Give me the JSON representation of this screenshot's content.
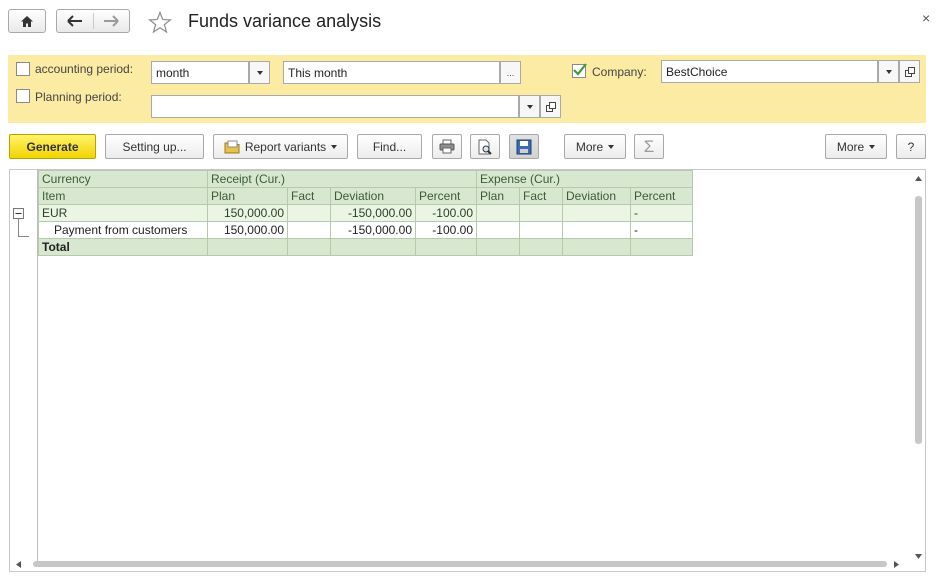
{
  "window": {
    "title": "Funds variance analysis",
    "close_glyph": "×",
    "nav_icons": [
      "home-icon",
      "back-arrow-icon",
      "forward-arrow-icon",
      "favorite-star-icon"
    ]
  },
  "filters": {
    "accounting_period": {
      "checked": false,
      "label": "accounting period:",
      "period_type": "month",
      "period_value": "This month",
      "select_button": "..."
    },
    "planning_period": {
      "checked": false,
      "label": "Planning period:",
      "value": ""
    },
    "company": {
      "checked": true,
      "label": "Company:",
      "value": "BestChoice"
    }
  },
  "toolbar": {
    "generate": "Generate",
    "setting_up": "Setting up...",
    "report_variants": "Report variants",
    "find": "Find...",
    "more_left": "More",
    "sum_symbol": "Σ",
    "more_right": "More",
    "help": "?",
    "icons": [
      "print-icon",
      "preview-icon",
      "save-icon",
      "sum-icon",
      "report-variants-icon"
    ]
  },
  "report": {
    "header": {
      "currency": "Currency",
      "item": "Item",
      "receipt_group": "Receipt (Cur.)",
      "expense_group": "Expense (Cur.)",
      "plan": "Plan",
      "fact": "Fact",
      "deviation": "Deviation",
      "percent": "Percent"
    },
    "rows": [
      {
        "name": "EUR",
        "receipt_plan": "150,000.00",
        "receipt_fact": "",
        "receipt_deviation": "-150,000.00",
        "receipt_percent": "-100.00",
        "expense_plan": "",
        "expense_fact": "",
        "expense_deviation": "",
        "expense_percent": "-"
      },
      {
        "name": "Payment from customers",
        "receipt_plan": "150,000.00",
        "receipt_fact": "",
        "receipt_deviation": "-150,000.00",
        "receipt_percent": "-100.00",
        "expense_plan": "",
        "expense_fact": "",
        "expense_deviation": "",
        "expense_percent": "-"
      },
      {
        "name": "Total",
        "receipt_plan": "",
        "receipt_fact": "",
        "receipt_deviation": "",
        "receipt_percent": "",
        "expense_plan": "",
        "expense_fact": "",
        "expense_deviation": "",
        "expense_percent": ""
      }
    ]
  },
  "colors": {
    "filter_panel": "#fbeba3",
    "primary_button": "#f2d400",
    "header_green": "#d8e8d0",
    "group_row_green": "#eaf5e4",
    "checkbox_check": "#3f9a3b"
  }
}
